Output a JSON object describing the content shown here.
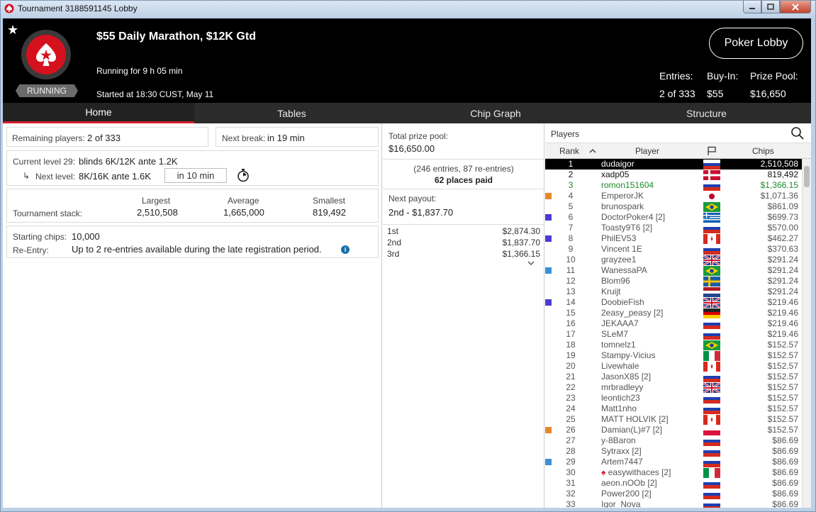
{
  "window": {
    "title": "Tournament 3188591145 Lobby"
  },
  "header": {
    "status": "RUNNING",
    "title": "$55 Daily Marathon, $12K Gtd",
    "running_for": "Running for 9 h 05 min",
    "started": "Started at 18:30 CUST, May 11",
    "lobby_button": "Poker Lobby",
    "entries_label": "Entries:",
    "entries_value": "2 of 333",
    "buyin_label": "Buy-In:",
    "buyin_value": "$55",
    "prizepool_label": "Prize Pool:",
    "prizepool_value": "$16,650"
  },
  "tabs": [
    "Home",
    "Tables",
    "Chip Graph",
    "Structure"
  ],
  "home": {
    "remaining_label": "Remaining players:",
    "remaining_value": "2 of 333",
    "next_break_label": "Next break:",
    "next_break_value": "in 19 min",
    "current_level_label": "Current level 29:",
    "current_level_value": "blinds 6K/12K ante 1.2K",
    "next_level_label": "Next level:",
    "next_level_value": "8K/16K ante 1.6K",
    "next_level_time": "in 10 min",
    "stack_label": "Tournament stack:",
    "largest_label": "Largest",
    "largest_value": "2,510,508",
    "average_label": "Average",
    "average_value": "1,665,000",
    "smallest_label": "Smallest",
    "smallest_value": "819,492",
    "starting_chips_label": "Starting chips:",
    "starting_chips_value": "10,000",
    "reentry_label": "Re-Entry:",
    "reentry_value": "Up to 2 re-entries available during the late registration period."
  },
  "prizes": {
    "total_label": "Total prize pool:",
    "total_value": "$16,650.00",
    "entries_note": "(246 entries, 87 re-entries)",
    "places_paid": "62 places paid",
    "next_payout_label": "Next payout:",
    "next_payout_value": "2nd - $1,837.70",
    "places": [
      {
        "place": "1st",
        "amount": "$2,874.30"
      },
      {
        "place": "2nd",
        "amount": "$1,837.70"
      },
      {
        "place": "3rd",
        "amount": "$1,366.15"
      }
    ]
  },
  "players": {
    "title": "Players",
    "col_rank": "Rank",
    "col_player": "Player",
    "col_chips": "Chips",
    "rows": [
      {
        "rank": "1",
        "player": "dudaigor",
        "chips": "2,510,508",
        "marker": "",
        "flag": "ru",
        "style": "hl"
      },
      {
        "rank": "2",
        "player": "xadp05",
        "chips": "819,492",
        "marker": "",
        "flag": "dk",
        "style": "dark"
      },
      {
        "rank": "3",
        "player": "romon151604",
        "chips": "$1,366.15",
        "marker": "",
        "flag": "ru",
        "style": "green"
      },
      {
        "rank": "4",
        "player": "EmperorJK",
        "chips": "$1,071.36",
        "marker": "#e8872a",
        "flag": "jp",
        "style": ""
      },
      {
        "rank": "5",
        "player": "brunospark",
        "chips": "$861.09",
        "marker": "",
        "flag": "br",
        "style": ""
      },
      {
        "rank": "6",
        "player": "DoctorPoker4 [2]",
        "chips": "$699.73",
        "marker": "#4a3bd0",
        "flag": "gr",
        "style": ""
      },
      {
        "rank": "7",
        "player": "Toasty9T6 [2]",
        "chips": "$570.00",
        "marker": "",
        "flag": "ru",
        "style": ""
      },
      {
        "rank": "8",
        "player": "PhilEV53",
        "chips": "$462.27",
        "marker": "#4a3bd0",
        "flag": "ca",
        "style": ""
      },
      {
        "rank": "9",
        "player": "Vincent 1E",
        "chips": "$370.63",
        "marker": "",
        "flag": "ru",
        "style": ""
      },
      {
        "rank": "10",
        "player": "grayzee1",
        "chips": "$291.24",
        "marker": "",
        "flag": "gb",
        "style": ""
      },
      {
        "rank": "11",
        "player": "WanessaPA",
        "chips": "$291.24",
        "marker": "#3a8fd8",
        "flag": "br",
        "style": ""
      },
      {
        "rank": "12",
        "player": "Blom96",
        "chips": "$291.24",
        "marker": "",
        "flag": "se",
        "style": ""
      },
      {
        "rank": "13",
        "player": "Kruijt",
        "chips": "$291.24",
        "marker": "",
        "flag": "nl",
        "style": ""
      },
      {
        "rank": "14",
        "player": "DoobieFish",
        "chips": "$219.46",
        "marker": "#4a3bd0",
        "flag": "gb",
        "style": ""
      },
      {
        "rank": "15",
        "player": "2easy_peasy [2]",
        "chips": "$219.46",
        "marker": "",
        "flag": "de",
        "style": ""
      },
      {
        "rank": "16",
        "player": "JEKAAA7",
        "chips": "$219.46",
        "marker": "",
        "flag": "ru",
        "style": ""
      },
      {
        "rank": "17",
        "player": "SLeM7",
        "chips": "$219.46",
        "marker": "",
        "flag": "ru",
        "style": ""
      },
      {
        "rank": "18",
        "player": "tomnelz1",
        "chips": "$152.57",
        "marker": "",
        "flag": "br",
        "style": ""
      },
      {
        "rank": "19",
        "player": "Stampy-Vicius",
        "chips": "$152.57",
        "marker": "",
        "flag": "it",
        "style": ""
      },
      {
        "rank": "20",
        "player": "Livewhale",
        "chips": "$152.57",
        "marker": "",
        "flag": "ca",
        "style": ""
      },
      {
        "rank": "21",
        "player": "JasonX85 [2]",
        "chips": "$152.57",
        "marker": "",
        "flag": "ru",
        "style": ""
      },
      {
        "rank": "22",
        "player": "mrbradleyy",
        "chips": "$152.57",
        "marker": "",
        "flag": "gb",
        "style": ""
      },
      {
        "rank": "23",
        "player": "leontich23",
        "chips": "$152.57",
        "marker": "",
        "flag": "ru",
        "style": ""
      },
      {
        "rank": "24",
        "player": "Matt1nho",
        "chips": "$152.57",
        "marker": "",
        "flag": "ru",
        "style": ""
      },
      {
        "rank": "25",
        "player": "MATT HOLVIK [2]",
        "chips": "$152.57",
        "marker": "",
        "flag": "ca",
        "style": ""
      },
      {
        "rank": "26",
        "player": "Damian(L)#7 [2]",
        "chips": "$152.57",
        "marker": "#e8872a",
        "flag": "pl",
        "style": ""
      },
      {
        "rank": "27",
        "player": "y-8Baron",
        "chips": "$86.69",
        "marker": "",
        "flag": "ru",
        "style": ""
      },
      {
        "rank": "28",
        "player": "Sytraxx [2]",
        "chips": "$86.69",
        "marker": "",
        "flag": "ru",
        "style": ""
      },
      {
        "rank": "29",
        "player": "Artem7447",
        "chips": "$86.69",
        "marker": "#3a8fd8",
        "flag": "ru",
        "style": ""
      },
      {
        "rank": "30",
        "player": "easywithaces [2]",
        "chips": "$86.69",
        "marker": "",
        "flag": "it",
        "style": "",
        "spade": true
      },
      {
        "rank": "31",
        "player": "aeon.nOOb [2]",
        "chips": "$86.69",
        "marker": "",
        "flag": "ru",
        "style": ""
      },
      {
        "rank": "32",
        "player": "Power200 [2]",
        "chips": "$86.69",
        "marker": "",
        "flag": "ru",
        "style": ""
      },
      {
        "rank": "33",
        "player": "Igor_Nova",
        "chips": "$86.69",
        "marker": "",
        "flag": "ru",
        "style": ""
      }
    ]
  },
  "colors": {
    "accent_red": "#d21f2a",
    "green_text": "#1d8a2b",
    "marker_orange": "#e8872a",
    "marker_purple": "#4a3bd0",
    "marker_blue": "#3a8fd8"
  }
}
